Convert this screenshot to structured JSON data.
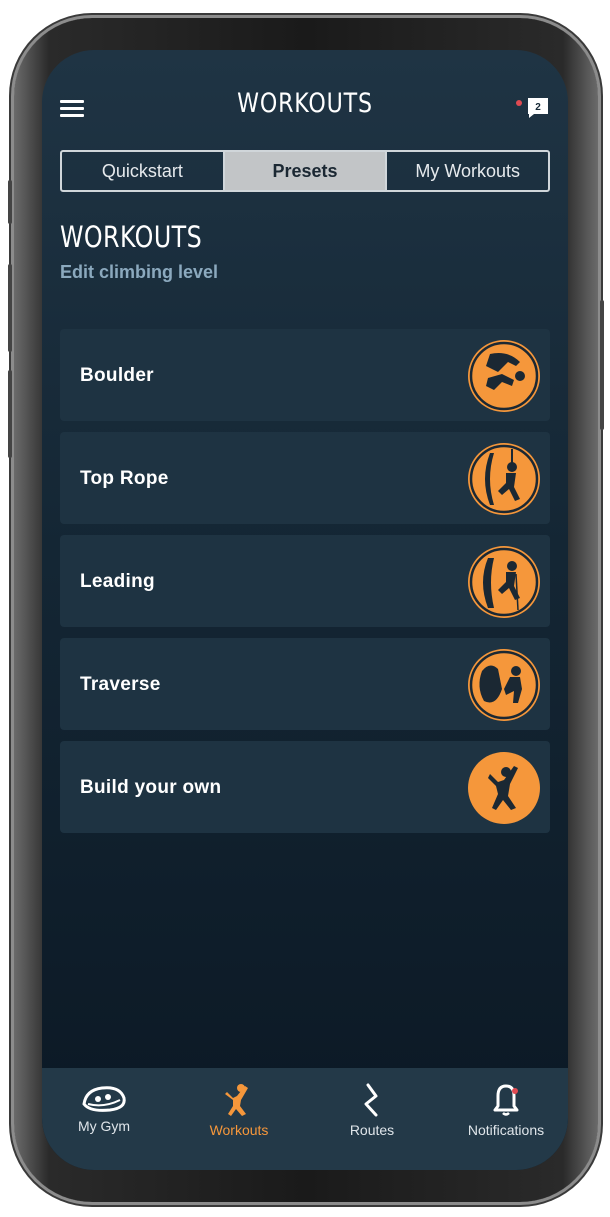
{
  "header": {
    "title": "WORKOUTS",
    "menu_icon": "hamburger-menu-icon",
    "inbox_icon": "chat-bubble-icon",
    "inbox_badge": "2"
  },
  "segments": [
    {
      "label": "Quickstart",
      "active": false
    },
    {
      "label": "Presets",
      "active": true
    },
    {
      "label": "My Workouts",
      "active": false
    }
  ],
  "section": {
    "title": "WORKOUTS",
    "link": "Edit climbing level"
  },
  "workouts": [
    {
      "label": "Boulder",
      "icon": "boulder-climber-icon"
    },
    {
      "label": "Top Rope",
      "icon": "top-rope-climber-icon"
    },
    {
      "label": "Leading",
      "icon": "lead-climber-icon"
    },
    {
      "label": "Traverse",
      "icon": "traverse-climber-icon"
    },
    {
      "label": "Build your own",
      "icon": "jumping-climber-icon"
    }
  ],
  "tabbar": [
    {
      "label": "My Gym",
      "icon": "climbing-hold-icon",
      "active": false
    },
    {
      "label": "Workouts",
      "icon": "climber-icon",
      "active": true
    },
    {
      "label": "Routes",
      "icon": "route-zigzag-icon",
      "active": false
    },
    {
      "label": "Notifications",
      "icon": "bell-icon",
      "active": false
    }
  ],
  "colors": {
    "accent": "#f5973b",
    "card": "#1e3342",
    "background": "#142634",
    "link": "#8ba9be",
    "notification_dot": "#e04a52"
  }
}
